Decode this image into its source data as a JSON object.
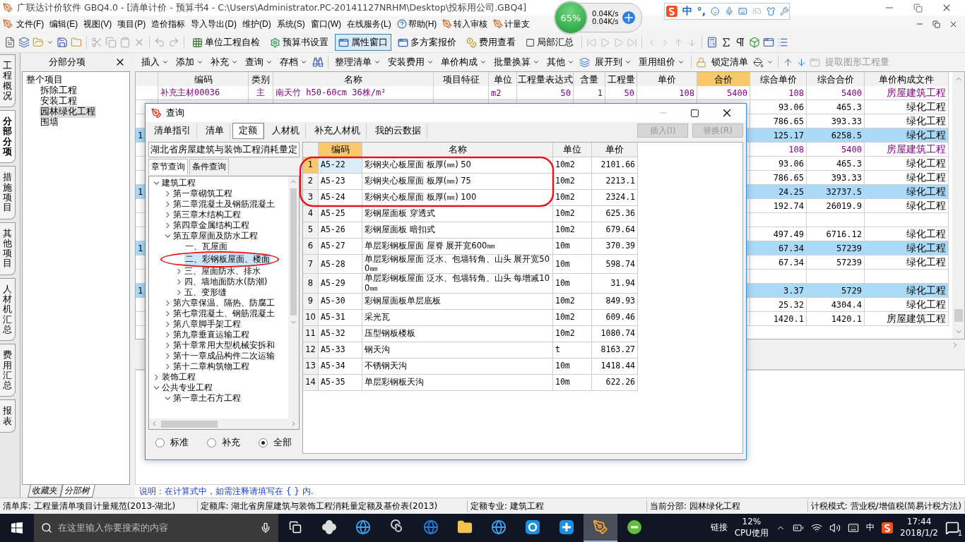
{
  "window": {
    "title": "广联达计价软件 GBQ4.0 - [清单计价 - 预算书4 - C:\\Users\\Administrator.PC-20141127NRHM\\Desktop\\投标用公司.GBQ4]"
  },
  "menu": [
    {
      "label": "文件(F)",
      "kind": "plain"
    },
    {
      "label": "编辑(E)",
      "kind": "plain"
    },
    {
      "label": "视图(V)",
      "kind": "plain"
    },
    {
      "label": "项目(P)",
      "kind": "plain"
    },
    {
      "label": "造价指标",
      "kind": "plain"
    },
    {
      "label": "导入导出(D)",
      "kind": "plain"
    },
    {
      "label": "维护(D)",
      "kind": "plain"
    },
    {
      "label": "系统(S)",
      "kind": "plain"
    },
    {
      "label": "窗口(W)",
      "kind": "plain"
    },
    {
      "label": "在线服务(L)",
      "kind": "plain"
    },
    {
      "label": "帮助(H)",
      "kind": "help"
    },
    {
      "label": "转入审核",
      "kind": "tool"
    },
    {
      "label": "计量支",
      "kind": "tool"
    }
  ],
  "toolbar": {
    "buttons": [
      {
        "label": "单位工程自检",
        "pressed": false,
        "kind": "grid"
      },
      {
        "label": "预算书设置",
        "pressed": false,
        "kind": "gear"
      },
      {
        "label": "属性窗口",
        "pressed": true,
        "kind": "window"
      },
      {
        "label": "多方案报价",
        "pressed": false,
        "kind": "window"
      },
      {
        "label": "费用查看",
        "pressed": false,
        "kind": "coins"
      }
    ],
    "checkbox": {
      "label": "局部汇总",
      "checked": false
    }
  },
  "side_tabs": [
    {
      "label": "工程概况",
      "selected": false
    },
    {
      "label": "分部分项",
      "selected": true
    },
    {
      "label": "措施项目",
      "selected": false
    },
    {
      "label": "其他项目",
      "selected": false
    },
    {
      "label": "人材机汇总",
      "selected": false
    },
    {
      "label": "费用汇总",
      "selected": false
    },
    {
      "label": "报表",
      "selected": false
    }
  ],
  "left_panel": {
    "title": "分部分项",
    "root": "整个项目",
    "items": [
      {
        "label": "拆除工程",
        "selected": false
      },
      {
        "label": "安装工程",
        "selected": false
      },
      {
        "label": "园林绿化工程",
        "selected": true
      },
      {
        "label": "围墙",
        "selected": false
      }
    ],
    "tabs": [
      {
        "label": "收藏夹",
        "selected": false
      },
      {
        "label": "分部树",
        "selected": true
      }
    ]
  },
  "edit_toolbar": [
    {
      "label": "插入",
      "dropdown": true,
      "disabled": false
    },
    {
      "label": "添加",
      "dropdown": true,
      "disabled": false
    },
    {
      "label": "补充",
      "dropdown": true,
      "disabled": false
    },
    {
      "label": "查询",
      "dropdown": true,
      "disabled": false
    },
    {
      "label": "存档",
      "dropdown": true,
      "disabled": false
    },
    {
      "label": "整理清单",
      "dropdown": true,
      "disabled": false
    },
    {
      "label": "安装费用",
      "dropdown": true,
      "disabled": false
    },
    {
      "label": "单价构成",
      "dropdown": true,
      "disabled": false
    },
    {
      "label": "批量换算",
      "dropdown": true,
      "disabled": false
    },
    {
      "label": "其他",
      "dropdown": true,
      "disabled": false
    },
    {
      "label": "展开到",
      "dropdown": true,
      "disabled": false
    },
    {
      "label": "重用组价",
      "dropdown": true,
      "disabled": false
    },
    {
      "label": "锁定清单",
      "dropdown": false,
      "disabled": false
    },
    {
      "label": "提取图形工程量",
      "dropdown": false,
      "disabled": true
    }
  ],
  "table": {
    "columns": [
      {
        "label": "编码",
        "selected": false
      },
      {
        "label": "类别",
        "selected": false
      },
      {
        "label": "名称",
        "selected": false
      },
      {
        "label": "项目特征",
        "selected": false
      },
      {
        "label": "单位",
        "selected": false
      },
      {
        "label": "工程量表达式",
        "selected": false
      },
      {
        "label": "含量",
        "selected": false
      },
      {
        "label": "工程量",
        "selected": false
      },
      {
        "label": "单价",
        "selected": false
      },
      {
        "label": "合价",
        "selected": true
      },
      {
        "label": "综合单价",
        "selected": false
      },
      {
        "label": "综合合价",
        "selected": false
      },
      {
        "label": "单价构成文件",
        "selected": false
      }
    ],
    "rows": [
      {
        "kind": "material",
        "highlighted": false,
        "code": "补充主材00036",
        "category": "主",
        "name": "南天竹 h50-60cm 36株/m²",
        "unit": "m2",
        "expression": "50",
        "content": "1",
        "quantity": "50",
        "price": "108",
        "amount": "5400",
        "unit_price": "108",
        "total_price": "5400",
        "price_file": "房屋建筑工程"
      },
      {
        "kind": "normal",
        "highlighted": false,
        "unit_price": "93.06",
        "total_price": "465.3",
        "price_file": "绿化工程"
      },
      {
        "kind": "normal",
        "highlighted": false,
        "unit_price": "786.65",
        "total_price": "393.33",
        "price_file": "绿化工程"
      },
      {
        "kind": "normal",
        "highlighted": true,
        "no": "1",
        "unit_price": "125.17",
        "total_price": "6258.5",
        "price_file": "绿化工程"
      },
      {
        "kind": "material",
        "highlighted": false,
        "unit_price": "108",
        "total_price": "5400",
        "price_file": "房屋建筑工程"
      },
      {
        "kind": "normal",
        "highlighted": false,
        "unit_price": "93.06",
        "total_price": "465.3",
        "price_file": "绿化工程"
      },
      {
        "kind": "normal",
        "highlighted": false,
        "unit_price": "786.65",
        "total_price": "393.33",
        "price_file": "绿化工程"
      },
      {
        "kind": "normal",
        "highlighted": true,
        "no": "1",
        "unit_price": "24.25",
        "total_price": "32737.5",
        "price_file": "绿化工程"
      },
      {
        "kind": "normal",
        "highlighted": false,
        "unit_price": "192.74",
        "total_price": "26019.9",
        "price_file": "绿化工程"
      },
      {
        "kind": "normal",
        "highlighted": false
      },
      {
        "kind": "normal",
        "highlighted": false,
        "unit_price": "497.49",
        "total_price": "6716.12",
        "price_file": "绿化工程"
      },
      {
        "kind": "normal",
        "highlighted": true,
        "no": "1",
        "unit_price": "67.34",
        "total_price": "57239",
        "price_file": "绿化工程"
      },
      {
        "kind": "normal",
        "highlighted": false,
        "unit_price": "67.34",
        "total_price": "57239",
        "price_file": "绿化工程"
      },
      {
        "kind": "normal",
        "highlighted": false
      },
      {
        "kind": "normal",
        "highlighted": true,
        "no": "1",
        "unit_price": "3.37",
        "total_price": "5729",
        "price_file": "绿化工程"
      },
      {
        "kind": "normal",
        "highlighted": false,
        "unit_price": "25.32",
        "total_price": "4304.4",
        "price_file": "绿化工程"
      },
      {
        "kind": "normal",
        "highlighted": false,
        "unit_price": "1420.1",
        "total_price": "1420.1",
        "price_file": "房屋建筑工程"
      }
    ]
  },
  "hint": "说明：在计算式中，如需注释请填写在 { } 内.",
  "status_bar": [
    "清单库: 工程量清单项目计量规范(2013-湖北)",
    "定额库: 湖北省房屋建筑与装饰工程消耗量定额及基价表(2013)",
    "定额专业: 建筑工程",
    "当前分部: 园林绿化工程",
    "计税模式: 营业税/增值税(简易计税方法)"
  ],
  "dialog": {
    "title": "查询",
    "tabs": [
      {
        "label": "清单指引",
        "selected": false
      },
      {
        "label": "清单",
        "selected": false
      },
      {
        "label": "定额",
        "selected": true
      },
      {
        "label": "人材机",
        "selected": false
      },
      {
        "label": "补充人材机",
        "selected": false
      },
      {
        "label": "我的云数据",
        "selected": false
      }
    ],
    "buttons": [
      {
        "label": "插入(I)",
        "disabled": true
      },
      {
        "label": "替换(R)",
        "disabled": true
      }
    ],
    "library": "湖北省房屋建筑与装饰工程消耗量定",
    "subtabs": [
      {
        "label": "章节查询",
        "selected": true
      },
      {
        "label": "条件查询",
        "selected": false
      }
    ],
    "tree": [
      {
        "label": "建筑工程",
        "expanded": true,
        "selected": false,
        "children": [
          {
            "label": "第一章砌筑工程",
            "expanded": false,
            "selected": false
          },
          {
            "label": "第二章混凝土及钢筋混凝土",
            "expanded": false,
            "selected": false
          },
          {
            "label": "第三章木结构工程",
            "expanded": false,
            "selected": false
          },
          {
            "label": "第四章金属结构工程",
            "expanded": false,
            "selected": false
          },
          {
            "label": "第五章屋面及防水工程",
            "expanded": true,
            "selected": false,
            "children": [
              {
                "label": "一、瓦屋面",
                "selected": false
              },
              {
                "label": "二、彩钢板屋面、楼面",
                "selected": true
              },
              {
                "label": "三、屋面防水、排水",
                "expanded": false,
                "selected": false
              },
              {
                "label": "四、墙地面防水(防潮)",
                "expanded": false,
                "selected": false
              },
              {
                "label": "五、变形缝",
                "expanded": false,
                "selected": false
              }
            ]
          },
          {
            "label": "第六章保温、隔热、防腐工",
            "expanded": false,
            "selected": false
          },
          {
            "label": "第七章混凝土、钢筋混凝土",
            "expanded": false,
            "selected": false
          },
          {
            "label": "第八章脚手架工程",
            "expanded": false,
            "selected": false
          },
          {
            "label": "第九章垂直运输工程",
            "expanded": false,
            "selected": false
          },
          {
            "label": "第十章常用大型机械安拆和",
            "expanded": false,
            "selected": false
          },
          {
            "label": "第十一章成品构件二次运输",
            "expanded": false,
            "selected": false
          },
          {
            "label": "第十二章构筑物工程",
            "expanded": false,
            "selected": false
          }
        ]
      },
      {
        "label": "装饰工程",
        "expanded": false,
        "selected": false
      },
      {
        "label": "公共专业工程",
        "expanded": true,
        "selected": false,
        "children": [
          {
            "label": "第一章土石方工程",
            "expanded": true,
            "selected": false
          }
        ]
      }
    ],
    "filters": [
      {
        "label": "标准",
        "selected": false
      },
      {
        "label": "补充",
        "selected": false
      },
      {
        "label": "全部",
        "selected": true
      }
    ],
    "columns": [
      "编码",
      "名称",
      "单位",
      "单价"
    ],
    "rows": [
      {
        "no": "1",
        "code": "A5-22",
        "name": "彩钢夹心板屋面 板厚(㎜) 50",
        "unit": "10m2",
        "price": "2101.66",
        "selected": true
      },
      {
        "no": "2",
        "code": "A5-23",
        "name": "彩钢夹心板屋面 板厚(㎜) 75",
        "unit": "10m2",
        "price": "2213.1",
        "selected": false
      },
      {
        "no": "3",
        "code": "A5-24",
        "name": "彩钢夹心板屋面 板厚(㎜) 100",
        "unit": "10m2",
        "price": "2324.1",
        "selected": false
      },
      {
        "no": "4",
        "code": "A5-25",
        "name": "彩钢屋面板 穿透式",
        "unit": "10m2",
        "price": "625.36",
        "selected": false
      },
      {
        "no": "5",
        "code": "A5-26",
        "name": "彩钢屋面板 暗扣式",
        "unit": "10m2",
        "price": "679.64",
        "selected": false
      },
      {
        "no": "6",
        "code": "A5-27",
        "name": "单层彩钢板屋面 屋脊 展开宽600㎜",
        "unit": "10m",
        "price": "370.39",
        "selected": false
      },
      {
        "no": "7",
        "code": "A5-28",
        "name": "单层彩钢板屋面 泛水、包墙转角、山头 展开宽500㎜",
        "unit": "10m",
        "price": "598.74",
        "selected": false
      },
      {
        "no": "8",
        "code": "A5-29",
        "name": "单层彩钢板屋面 泛水、包墙转角、山头 每增减100㎜",
        "unit": "10m",
        "price": "31.94",
        "selected": false
      },
      {
        "no": "9",
        "code": "A5-30",
        "name": "彩钢屋面板单层底板",
        "unit": "10m2",
        "price": "849.93",
        "selected": false
      },
      {
        "no": "10",
        "code": "A5-31",
        "name": "采光瓦",
        "unit": "10m2",
        "price": "609.46",
        "selected": false
      },
      {
        "no": "11",
        "code": "A5-32",
        "name": "压型钢板楼板",
        "unit": "10m2",
        "price": "1080.74",
        "selected": false
      },
      {
        "no": "12",
        "code": "A5-33",
        "name": "钢天沟",
        "unit": "t",
        "price": "8163.27",
        "selected": false
      },
      {
        "no": "13",
        "code": "A5-34",
        "name": "不锈钢天沟",
        "unit": "10m",
        "price": "1418.44",
        "selected": false
      },
      {
        "no": "14",
        "code": "A5-35",
        "name": "单层彩钢板天沟",
        "unit": "10m",
        "price": "622.26",
        "selected": false
      }
    ]
  },
  "speed_widget": {
    "percent": "65%",
    "upload": "0.04K/s",
    "download": "0.04K/s"
  },
  "ime_bar": {
    "mode": "中",
    "punct": "°,"
  },
  "taskbar": {
    "search_placeholder": "在这里输入你要搜索的内容",
    "apps": [
      {
        "kind": "pinwheel",
        "active": false
      },
      {
        "kind": "ie",
        "active": false
      },
      {
        "kind": "spiral",
        "active": false
      },
      {
        "kind": "edge",
        "active": false
      },
      {
        "kind": "folder",
        "active": false
      },
      {
        "kind": "ie",
        "active": false
      },
      {
        "kind": "g",
        "active": false
      },
      {
        "kind": "plus",
        "active": false
      },
      {
        "kind": "gbq",
        "active": true
      },
      {
        "kind": "green",
        "active": false
      }
    ],
    "link": "链接",
    "cpu": "12%",
    "cpu_label": "CPU使用",
    "ime": "中",
    "time": "17:44",
    "date": "2018/1/2",
    "notifications": "1"
  }
}
